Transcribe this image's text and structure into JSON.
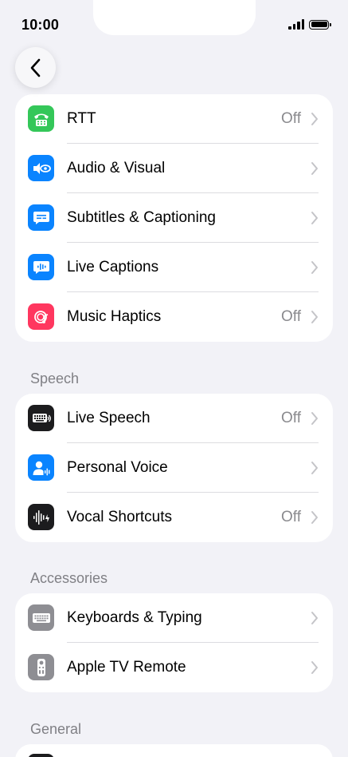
{
  "status": {
    "time": "10:00"
  },
  "groups": [
    {
      "header": "",
      "items": [
        {
          "label": "RTT",
          "value": "Off",
          "icon": "rtt-phone-icon",
          "color": "#34c759"
        },
        {
          "label": "Audio & Visual",
          "value": "",
          "icon": "audio-visual-icon",
          "color": "#0a84ff"
        },
        {
          "label": "Subtitles & Captioning",
          "value": "",
          "icon": "subtitles-icon",
          "color": "#0a84ff"
        },
        {
          "label": "Live Captions",
          "value": "",
          "icon": "live-captions-icon",
          "color": "#0a84ff"
        },
        {
          "label": "Music Haptics",
          "value": "Off",
          "icon": "music-haptics-icon",
          "color": "#ff375f"
        }
      ]
    },
    {
      "header": "Speech",
      "items": [
        {
          "label": "Live Speech",
          "value": "Off",
          "icon": "live-speech-keyboard-icon",
          "color": "#1c1c1e"
        },
        {
          "label": "Personal Voice",
          "value": "",
          "icon": "personal-voice-icon",
          "color": "#0a84ff"
        },
        {
          "label": "Vocal Shortcuts",
          "value": "Off",
          "icon": "waveform-icon",
          "color": "#1c1c1e"
        }
      ]
    },
    {
      "header": "Accessories",
      "items": [
        {
          "label": "Keyboards & Typing",
          "value": "",
          "icon": "keyboard-icon",
          "color": "#8e8e93"
        },
        {
          "label": "Apple TV Remote",
          "value": "",
          "icon": "tv-remote-icon",
          "color": "#8e8e93"
        }
      ]
    },
    {
      "header": "General",
      "items": []
    }
  ]
}
